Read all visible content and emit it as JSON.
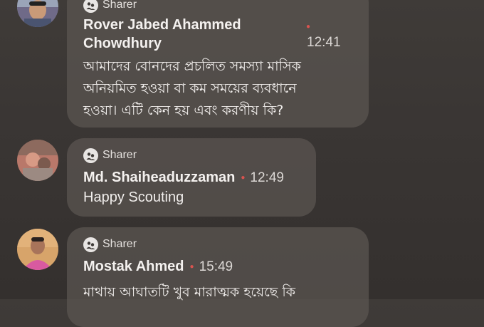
{
  "comments": [
    {
      "badge": "Sharer",
      "name_line1": "Rover Jabed Ahammed",
      "name_line2": "Chowdhury",
      "time": "12:41",
      "text_lines": [
        "আমাদের বোনদের প্রচলিত সমস্যা মাসিক",
        "অনিয়মিত হওয়া বা কম সময়ের ব্যবধানে",
        "হওয়া। এটি কেন হয় এবং করণীয় কি?"
      ]
    },
    {
      "badge": "Sharer",
      "name": "Md. Shaiheaduzzaman",
      "time": "12:49",
      "text": "Happy Scouting"
    },
    {
      "badge": "Sharer",
      "name": "Mostak Ahmed",
      "time": "15:49",
      "text": "মাথায় আঘাতটি খুব মারাত্মক হয়েছে কি"
    }
  ],
  "colors": {
    "background": "#3a3634",
    "bubble": "#5c5652",
    "dot": "#d9534f"
  },
  "icons": {
    "badge": "sharer-badge-icon"
  }
}
